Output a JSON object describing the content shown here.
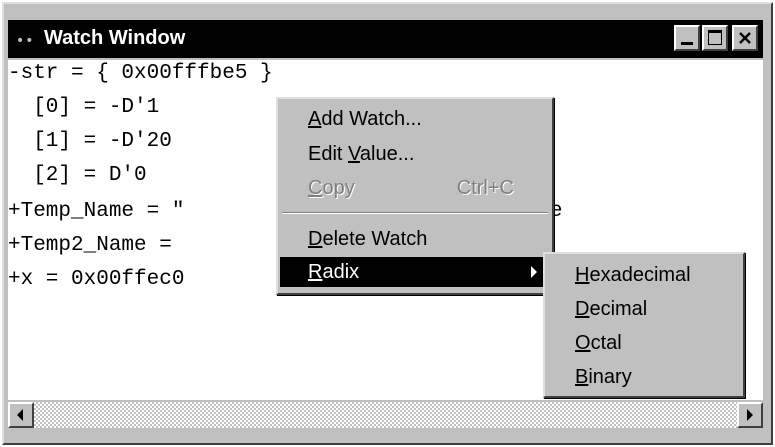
{
  "window": {
    "title": "Watch Window",
    "title_grip": "••"
  },
  "watch_lines": [
    "-str = { 0x00fffbe5 }",
    "  [0] = -D'1",
    "  [1] = -D'20",
    "  [2] = D'0",
    "+Temp_Name = \"                  stems Europe",
    "+Temp2_Name =",
    "+x = 0x00ffec0"
  ],
  "context_menu": {
    "items": [
      {
        "pre": "",
        "key": "A",
        "post": "dd Watch...",
        "enabled": true
      },
      {
        "pre": "Edit ",
        "key": "V",
        "post": "alue...",
        "enabled": true
      },
      {
        "pre": "",
        "key": "C",
        "post": "opy",
        "shortcut": "Ctrl+C",
        "enabled": false
      },
      {
        "pre": "",
        "key": "D",
        "post": "elete Watch",
        "enabled": true
      },
      {
        "pre": "",
        "key": "R",
        "post": "adix",
        "enabled": true,
        "highlighted": true
      }
    ]
  },
  "radix_submenu": {
    "items": [
      {
        "pre": "",
        "key": "H",
        "post": "exadecimal"
      },
      {
        "pre": "",
        "key": "D",
        "post": "ecimal"
      },
      {
        "pre": "",
        "key": "O",
        "post": "ctal"
      },
      {
        "pre": "",
        "key": "B",
        "post": "inary"
      }
    ]
  },
  "colors": {
    "titlebar": "#000000",
    "face": "#c0c0c0",
    "highlight": "#000000",
    "disabled_text": "#808080"
  }
}
